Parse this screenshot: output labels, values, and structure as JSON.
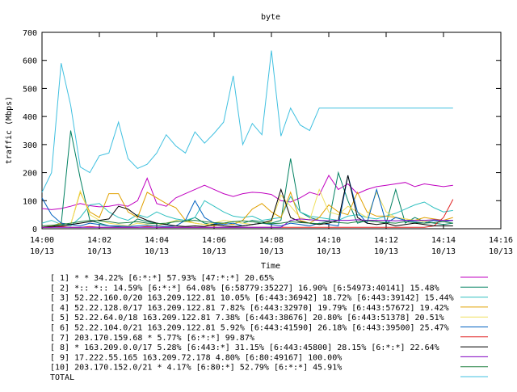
{
  "chart_data": {
    "type": "line",
    "title": "byte",
    "xlabel": "Time",
    "ylabel": "traffic (Mbps)",
    "ylim": [
      0,
      700
    ],
    "xlim": [
      "14:00",
      "14:16"
    ],
    "yticks": [
      "0",
      "100",
      "200",
      "300",
      "400",
      "500",
      "600",
      "700"
    ],
    "xticks": [
      {
        "time": "14:00",
        "date": "10/13"
      },
      {
        "time": "14:02",
        "date": "10/13"
      },
      {
        "time": "14:04",
        "date": "10/13"
      },
      {
        "time": "14:06",
        "date": "10/13"
      },
      {
        "time": "14:08",
        "date": "10/13"
      },
      {
        "time": "14:10",
        "date": "10/13"
      },
      {
        "time": "14:12",
        "date": "10/13"
      },
      {
        "time": "14:14",
        "date": "10/13"
      },
      {
        "time": "14:16",
        "date": "10/13"
      }
    ],
    "grid": false,
    "legend_position": "bottom",
    "x": [
      "14:00:00",
      "14:00:20",
      "14:00:40",
      "14:01:00",
      "14:01:20",
      "14:01:40",
      "14:02:00",
      "14:02:20",
      "14:02:40",
      "14:03:00",
      "14:03:20",
      "14:03:40",
      "14:04:00",
      "14:04:20",
      "14:04:40",
      "14:05:00",
      "14:05:20",
      "14:05:40",
      "14:06:00",
      "14:06:20",
      "14:06:40",
      "14:07:00",
      "14:07:20",
      "14:07:40",
      "14:08:00",
      "14:08:20",
      "14:08:40",
      "14:09:00",
      "14:09:20",
      "14:09:40",
      "14:10:00",
      "14:10:20",
      "14:10:40",
      "14:11:00",
      "14:11:20",
      "14:11:40",
      "14:12:00",
      "14:12:20",
      "14:12:40",
      "14:13:00",
      "14:13:20",
      "14:13:40",
      "14:14:00",
      "14:14:20"
    ],
    "series": [
      {
        "name": "[ 1] * * 34.22%  [6:*:*] 57.93% [47:*:*] 20.65%",
        "color": "#c000c0",
        "values": [
          72,
          68,
          72,
          80,
          90,
          82,
          78,
          80,
          86,
          80,
          100,
          180,
          90,
          80,
          110,
          125,
          140,
          155,
          140,
          125,
          115,
          125,
          130,
          128,
          122,
          100,
          95,
          110,
          130,
          120,
          190,
          140,
          160,
          125,
          140,
          150,
          155,
          160,
          165,
          150,
          160,
          155,
          150,
          155
        ]
      },
      {
        "name": "[ 2] *:: *:: 14.59%  [6:*:*] 64.08% [6:58779:35227] 16.90% [6:54973:40141] 15.48%",
        "color": "#008060",
        "values": [
          5,
          10,
          15,
          350,
          180,
          30,
          20,
          10,
          8,
          10,
          35,
          25,
          20,
          15,
          30,
          25,
          40,
          20,
          15,
          20,
          25,
          20,
          30,
          25,
          20,
          30,
          250,
          60,
          40,
          30,
          25,
          200,
          100,
          20,
          30,
          25,
          20,
          140,
          20,
          40,
          25,
          20,
          15,
          20
        ]
      },
      {
        "name": "[ 3] 52.22.160.0/20 163.209.122.81 10.05%  [6:443:36942] 18.72% [6:443:39142] 15.44%",
        "color": "#30c0c0",
        "values": [
          20,
          30,
          15,
          10,
          40,
          85,
          90,
          60,
          40,
          30,
          50,
          40,
          60,
          45,
          35,
          30,
          40,
          100,
          80,
          60,
          45,
          40,
          45,
          30,
          35,
          40,
          115,
          60,
          45,
          40,
          35,
          30,
          45,
          50,
          40,
          35,
          45,
          55,
          70,
          85,
          95,
          75,
          60,
          65
        ]
      },
      {
        "name": "[ 4] 52.22.128.0/17 163.209.122.81 7.82%  [6:443:32970] 19.79% [6:443:57672] 19.42%",
        "color": "#e0a000",
        "values": [
          5,
          10,
          20,
          15,
          130,
          60,
          40,
          125,
          125,
          60,
          40,
          130,
          110,
          90,
          75,
          30,
          20,
          15,
          10,
          20,
          15,
          30,
          70,
          90,
          60,
          40,
          130,
          30,
          20,
          40,
          85,
          60,
          50,
          130,
          60,
          45,
          45,
          40,
          35,
          30,
          40,
          35,
          30,
          40
        ]
      },
      {
        "name": "[ 5] 52.22.64.0/18 163.209.122.81 7.38%  [6:443:38676] 20.80% [6:443:51378] 20.51%",
        "color": "#f0e060",
        "values": [
          5,
          8,
          10,
          15,
          135,
          50,
          30,
          20,
          15,
          10,
          20,
          15,
          10,
          20,
          30,
          25,
          20,
          15,
          20,
          30,
          25,
          20,
          15,
          20,
          25,
          120,
          80,
          40,
          30,
          140,
          60,
          50,
          80,
          60,
          40,
          130,
          60,
          40,
          35,
          30,
          25,
          30,
          25,
          30
        ]
      },
      {
        "name": "[ 6] 52.22.104.0/21 163.209.122.81 5.92%  [6:443:41590] 26.18% [6:443:39500] 25.47%",
        "color": "#0060c0",
        "values": [
          110,
          50,
          20,
          15,
          10,
          20,
          15,
          10,
          10,
          8,
          10,
          12,
          10,
          8,
          10,
          30,
          100,
          40,
          20,
          15,
          20,
          10,
          15,
          20,
          15,
          10,
          20,
          15,
          10,
          20,
          15,
          10,
          190,
          60,
          20,
          140,
          20,
          40,
          30,
          25,
          20,
          30,
          25,
          30
        ]
      },
      {
        "name": "[ 7] 203.170.159.68 * 5.77%  [6:*:*] 99.87%",
        "color": "#e02020",
        "values": [
          5,
          5,
          8,
          5,
          5,
          8,
          5,
          5,
          5,
          5,
          5,
          8,
          5,
          5,
          5,
          5,
          5,
          5,
          5,
          5,
          5,
          5,
          5,
          5,
          5,
          5,
          5,
          5,
          5,
          5,
          5,
          5,
          5,
          5,
          5,
          5,
          5,
          5,
          5,
          5,
          5,
          10,
          40,
          105
        ]
      },
      {
        "name": "[ 8] * 163.209.0.0/17 5.28%  [6:443:*] 31.15% [6:443:45800] 28.15% [6:*:*] 22.64%",
        "color": "#000000",
        "values": [
          5,
          8,
          10,
          15,
          20,
          25,
          30,
          35,
          80,
          70,
          45,
          30,
          20,
          15,
          10,
          8,
          10,
          8,
          15,
          10,
          8,
          10,
          15,
          20,
          30,
          140,
          40,
          25,
          20,
          15,
          20,
          30,
          190,
          40,
          20,
          15,
          20,
          10,
          15,
          20,
          15,
          10,
          10,
          10
        ]
      },
      {
        "name": "[ 9] 17.222.55.165 163.209.72.178 4.80%  [6:80:49167] 100.00%",
        "color": "#8000c0",
        "values": [
          5,
          5,
          5,
          5,
          5,
          5,
          5,
          5,
          5,
          5,
          5,
          5,
          5,
          5,
          5,
          5,
          5,
          5,
          5,
          5,
          5,
          5,
          5,
          5,
          5,
          5,
          30,
          35,
          32,
          30,
          28,
          30,
          30,
          32,
          30,
          30,
          30,
          28,
          30,
          30,
          30,
          32,
          30,
          30
        ]
      },
      {
        "name": "[10] 203.170.152.0/21 * 4.17%  [6:80:*] 52.79% [6:*:*] 45.91%",
        "color": "#208040",
        "values": [
          10,
          12,
          15,
          20,
          25,
          30,
          28,
          25,
          20,
          22,
          25,
          20,
          18,
          20,
          25,
          28,
          30,
          25,
          22,
          20,
          25,
          28,
          25,
          20,
          18,
          20,
          25,
          22,
          20,
          18,
          25,
          22,
          20,
          25,
          28,
          25,
          22,
          20,
          25,
          22,
          20,
          22,
          25,
          20
        ]
      },
      {
        "name": "TOTAL",
        "color": "#40c0e0",
        "values": [
          130,
          200,
          590,
          440,
          220,
          200,
          260,
          270,
          380,
          250,
          215,
          230,
          270,
          335,
          295,
          270,
          345,
          305,
          340,
          380,
          545,
          300,
          375,
          335,
          635,
          330,
          430,
          370,
          350,
          430,
          430,
          430,
          430,
          430,
          430,
          430,
          430,
          430,
          430,
          430,
          430,
          430,
          430,
          430
        ]
      }
    ]
  }
}
